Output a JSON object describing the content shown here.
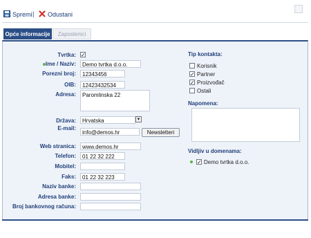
{
  "toolbar": {
    "save_label": "Spremi",
    "separator": "|",
    "cancel_label": "Odustani"
  },
  "tabs": [
    {
      "label": "Opće informacije",
      "active": true
    },
    {
      "label": "Zaposlenici",
      "active": false
    }
  ],
  "form": {
    "tvrtka": {
      "label": "Tvrtka:",
      "checked": true
    },
    "ime": {
      "label": "Ime / Naziv:",
      "value": "Demo tvrtka d.o.o."
    },
    "porezni": {
      "label": "Porezni broj:",
      "value": "12343456"
    },
    "oib": {
      "label": "OIB:",
      "value": "12423432534"
    },
    "adresa": {
      "label": "Adresa:",
      "value": "Paromlinska 22"
    },
    "drzava": {
      "label": "Država:",
      "value": "Hrvatska"
    },
    "email": {
      "label": "E-mail:",
      "value": "info@demos.hr",
      "button": "Newsletteri"
    },
    "web": {
      "label": "Web stranica:",
      "value": "www.demos.hr"
    },
    "telefon": {
      "label": "Telefon:",
      "value": "01 22 32 222"
    },
    "mobitel": {
      "label": "Mobitel:",
      "value": ""
    },
    "faks": {
      "label": "Faks:",
      "value": "01 22 32 223"
    },
    "banka": {
      "label": "Naziv banke:",
      "value": ""
    },
    "adresa_banke": {
      "label": "Adresa banke:",
      "value": ""
    },
    "racun": {
      "label": "Broj bankovnog računa:",
      "value": ""
    }
  },
  "contact_type": {
    "label": "Tip kontakta:",
    "options": [
      {
        "label": "Korisnik",
        "checked": false
      },
      {
        "label": "Partner",
        "checked": true
      },
      {
        "label": "Proizvođač",
        "checked": true
      },
      {
        "label": "Ostali",
        "checked": false
      }
    ]
  },
  "note": {
    "label": "Napomena:",
    "value": ""
  },
  "domains": {
    "label": "Vidljiv u domenama:",
    "item": {
      "label": "Demo tvrtka d.o.o.",
      "checked": true
    }
  },
  "colors": {
    "accent": "#2b4e86",
    "panel_bg": "#eef3fa",
    "label": "#223f78",
    "green_dot": "#5fb04a",
    "cancel_x": "#d2322d"
  },
  "icons": {
    "save": "floppy-disk-icon",
    "cancel": "red-x-icon",
    "checkmark": "checkmark-icon",
    "dropdown": "chevron-down-icon"
  }
}
